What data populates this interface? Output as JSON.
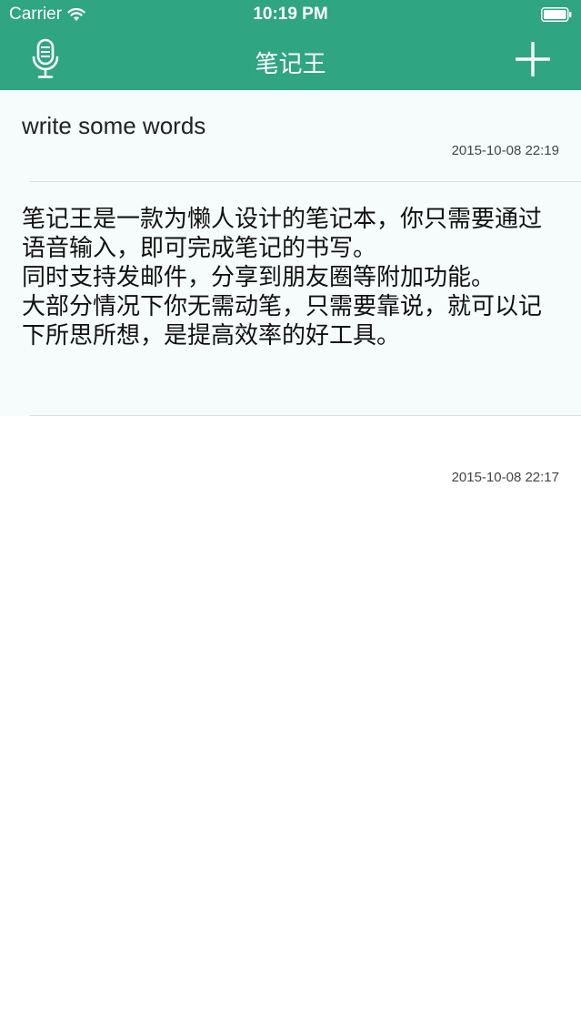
{
  "status_bar": {
    "carrier": "Carrier",
    "time": "10:19 PM",
    "icons": [
      "wifi-icon",
      "battery-icon"
    ]
  },
  "nav": {
    "title": "笔记王",
    "left_icon": "microphone-icon",
    "right_icon": "plus-icon",
    "color": "#2fa582"
  },
  "notes": [
    {
      "text": "write some words",
      "date": "2015-10-08 22:19"
    },
    {
      "text": "笔记王是一款为懒人设计的笔记本，你只需要通过语音输入，即可完成笔记的书写。\n同时支持发邮件，分享到朋友圈等附加功能。\n大部分情况下你无需动笔，只需要靠说，就可以记下所思所想，是提高效率的好工具。",
      "date": "2015-10-08 22:17"
    }
  ]
}
